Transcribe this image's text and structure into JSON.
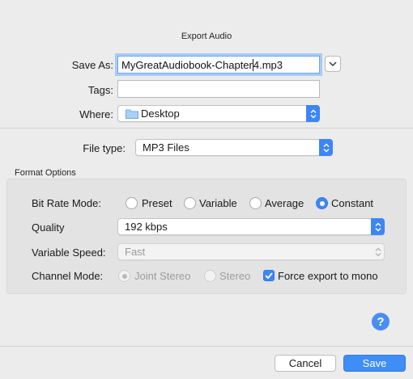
{
  "dialog": {
    "title": "Export Audio"
  },
  "save_as": {
    "label": "Save As:",
    "value_before_caret": "MyGreatAudiobook-Chapter",
    "value_after_caret": "4.mp3"
  },
  "tags": {
    "label": "Tags:",
    "value": ""
  },
  "where": {
    "label": "Where:",
    "value": "Desktop"
  },
  "file_type": {
    "label": "File type:",
    "value": "MP3 Files"
  },
  "format_options": {
    "heading": "Format Options",
    "bit_rate_mode": {
      "label": "Bit Rate Mode:",
      "options": [
        "Preset",
        "Variable",
        "Average",
        "Constant"
      ],
      "selected": "Constant"
    },
    "quality": {
      "label": "Quality",
      "value": "192 kbps"
    },
    "variable_speed": {
      "label": "Variable Speed:",
      "value": "Fast",
      "enabled": false
    },
    "channel_mode": {
      "label": "Channel Mode:",
      "options": [
        "Joint Stereo",
        "Stereo"
      ],
      "selected": "Joint Stereo",
      "enabled": false,
      "force_mono_label": "Force export to mono",
      "force_mono_checked": true
    }
  },
  "help": {
    "glyph": "?"
  },
  "buttons": {
    "cancel": "Cancel",
    "save": "Save"
  },
  "colors": {
    "accent": "#3d86f5",
    "background": "#ececec",
    "group_background": "#e3e3e3"
  }
}
